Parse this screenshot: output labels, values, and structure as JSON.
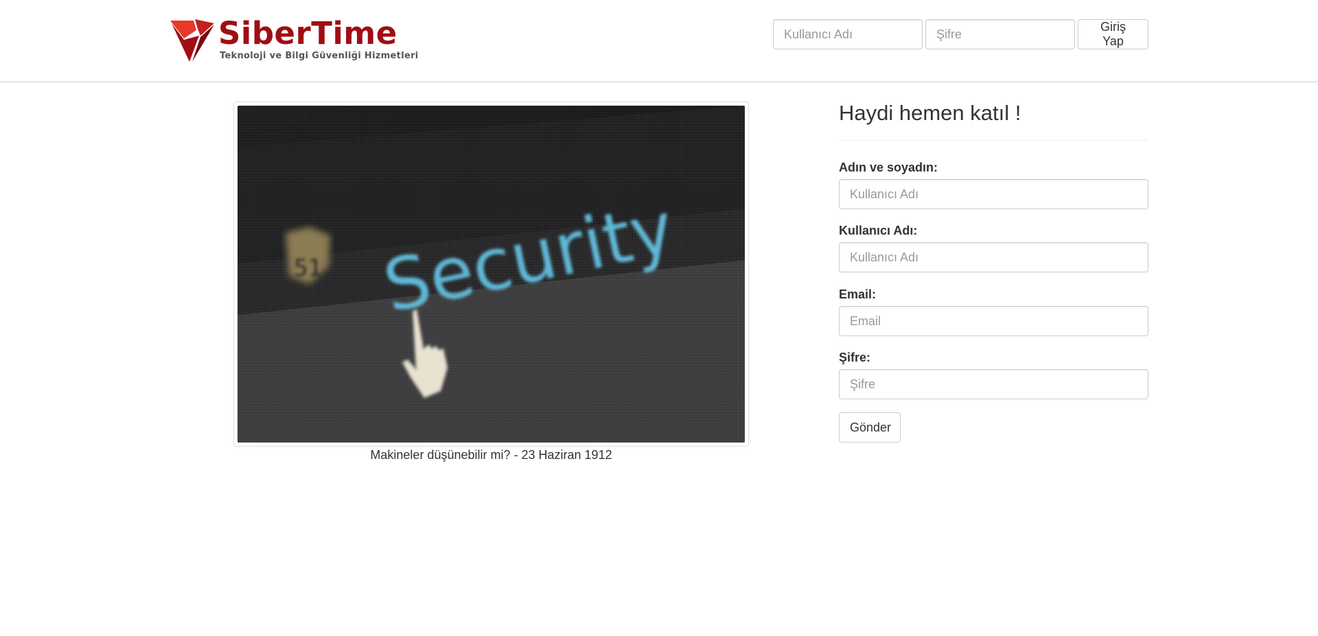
{
  "brand": {
    "name": "SiberTime",
    "tagline": "Teknoloji ve Bilgi Güvenliği Hizmetleri",
    "color_primary": "#a00d14",
    "color_accent": "#e8392a"
  },
  "header_login": {
    "username_placeholder": "Kullanıcı Adı",
    "password_placeholder": "Şifre",
    "submit_label": "Giriş Yap"
  },
  "feature_image": {
    "image_text": "Security",
    "badge_text": "51",
    "caption": "Makineler düşünebilir mi? - 23 Haziran 1912"
  },
  "signup": {
    "title": "Haydi hemen katıl !",
    "fields": [
      {
        "label": "Adın ve soyadın:",
        "placeholder": "Kullanıcı Adı"
      },
      {
        "label": "Kullanıcı Adı:",
        "placeholder": "Kullanıcı Adı"
      },
      {
        "label": "Email:",
        "placeholder": "Email"
      },
      {
        "label": "Şifre:",
        "placeholder": "Şifre"
      }
    ],
    "submit_label": "Gönder"
  }
}
